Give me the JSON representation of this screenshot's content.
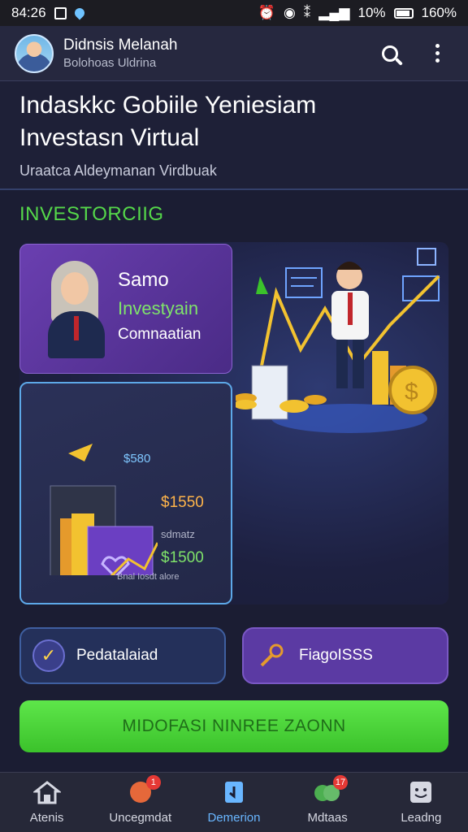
{
  "status_bar": {
    "time": "84:26",
    "battery_left": "10%",
    "battery_right": "160%"
  },
  "header": {
    "user_name": "Didnsis Melanah",
    "user_subtitle": "Bolohoas Uldrina"
  },
  "hero": {
    "title_line1": "Indaskkc Gobiile Yeniesiam",
    "title_line2": "Investasn Virtual",
    "subtitle": "Uraatca Aldeymanan Virdbuak"
  },
  "section_label": "INVESTORCIIG",
  "card_promo": {
    "line1": "Samo",
    "line2": "Investyain",
    "line3": "Comnaatian"
  },
  "card_books": {
    "value1": "$580",
    "value2": "$1550",
    "label": "sdmatz",
    "value3": "$1500",
    "footnote": "Bnal Iosdt alore"
  },
  "buttons": {
    "ped_label": "Pedatalaiad",
    "prog_label": "FiagoISSS",
    "cta_label": "MIDOFASI NINREE ZAONN"
  },
  "bottom_nav": [
    {
      "label": "Atenis",
      "icon": "home-icon",
      "badge": ""
    },
    {
      "label": "Uncegmdat",
      "icon": "chart-icon",
      "badge": "1"
    },
    {
      "label": "Demerion",
      "icon": "document-icon",
      "badge": "",
      "active": true
    },
    {
      "label": "Mdtaas",
      "icon": "people-icon",
      "badge": "17"
    },
    {
      "label": "Leadng",
      "icon": "smiley-icon",
      "badge": ""
    }
  ],
  "colors": {
    "accent_green": "#55d84a",
    "accent_purple": "#5b3aa3",
    "accent_blue": "#69b6ff",
    "background": "#1b1d33"
  }
}
